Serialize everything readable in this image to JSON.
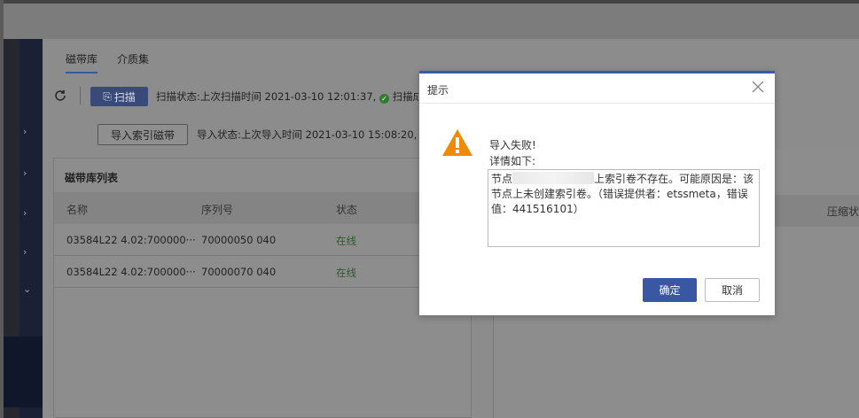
{
  "tabs": [
    "磁带库",
    "介质集"
  ],
  "toolbar": {
    "scan_label": "扫描",
    "scan_status": "扫描状态:上次扫描时间 2021-03-10 12:01:37,",
    "scan_status_tail": "扫描成",
    "import_label": "导入索引磁带",
    "import_status": "导入状态:上次导入时间 2021-03-10 15:08:20,"
  },
  "library_panel": {
    "title": "磁带库列表",
    "columns": [
      "名称",
      "序列号",
      "状态"
    ],
    "rows": [
      {
        "name": "03584L22 4.02:700000···",
        "serial": "70000050 040",
        "status": "在线"
      },
      {
        "name": "03584L22 4.02:700000···",
        "serial": "70000070 040",
        "status": "在线"
      }
    ]
  },
  "right_panel": {
    "column": "压缩状"
  },
  "dialog": {
    "title": "提示",
    "message": "导入失败!",
    "detail_label": "详情如下:",
    "detail_prefix": "节点",
    "detail_suffix": "上索引卷不存在。可能原因是：该节点上未创建索引卷。（错误提供者：etssmeta，错误值：441516101）",
    "ok_label": "确定",
    "cancel_label": "取消"
  },
  "colors": {
    "accent": "#3a57a4",
    "warning": "#f08a00"
  }
}
